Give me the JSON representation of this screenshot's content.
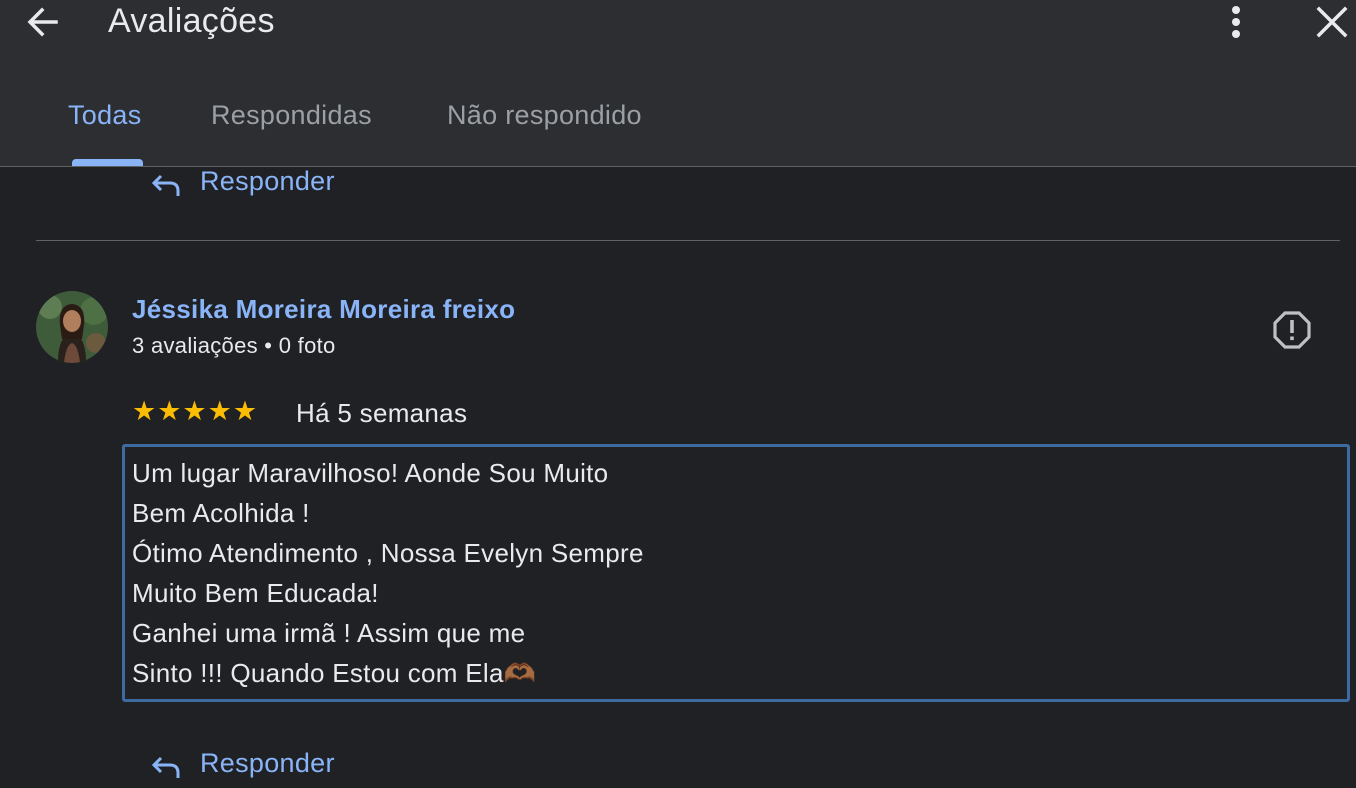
{
  "header": {
    "title": "Avaliações",
    "back_icon": "arrow-left-icon",
    "more_icon": "more-vert-icon",
    "close_icon": "close-icon"
  },
  "tabs": [
    {
      "label": "Todas",
      "active": true
    },
    {
      "label": "Respondidas",
      "active": false
    },
    {
      "label": "Não respondido",
      "active": false
    }
  ],
  "reply_label": "Responder",
  "review": {
    "reviewer_name": "Jéssika Moreira Moreira freixo",
    "reviewer_meta": "3 avaliações • 0 foto",
    "rating": 5,
    "stars": "★★★★★",
    "date": "Há 5 semanas",
    "text_lines": [
      "Um lugar Maravilhoso! Aonde Sou Muito",
      "Bem Acolhida !",
      "Ótimo Atendimento , Nossa Evelyn Sempre",
      "Muito Bem Educada!",
      "Ganhei uma irmã ! Assim que me",
      "Sinto !!! Quando Estou com Ela🫶🏾"
    ]
  },
  "colors": {
    "background": "#202124",
    "header_bg": "#2d2e31",
    "accent": "#8ab4f8",
    "star": "#fbbc04",
    "focus_border": "#3d6aa0"
  }
}
